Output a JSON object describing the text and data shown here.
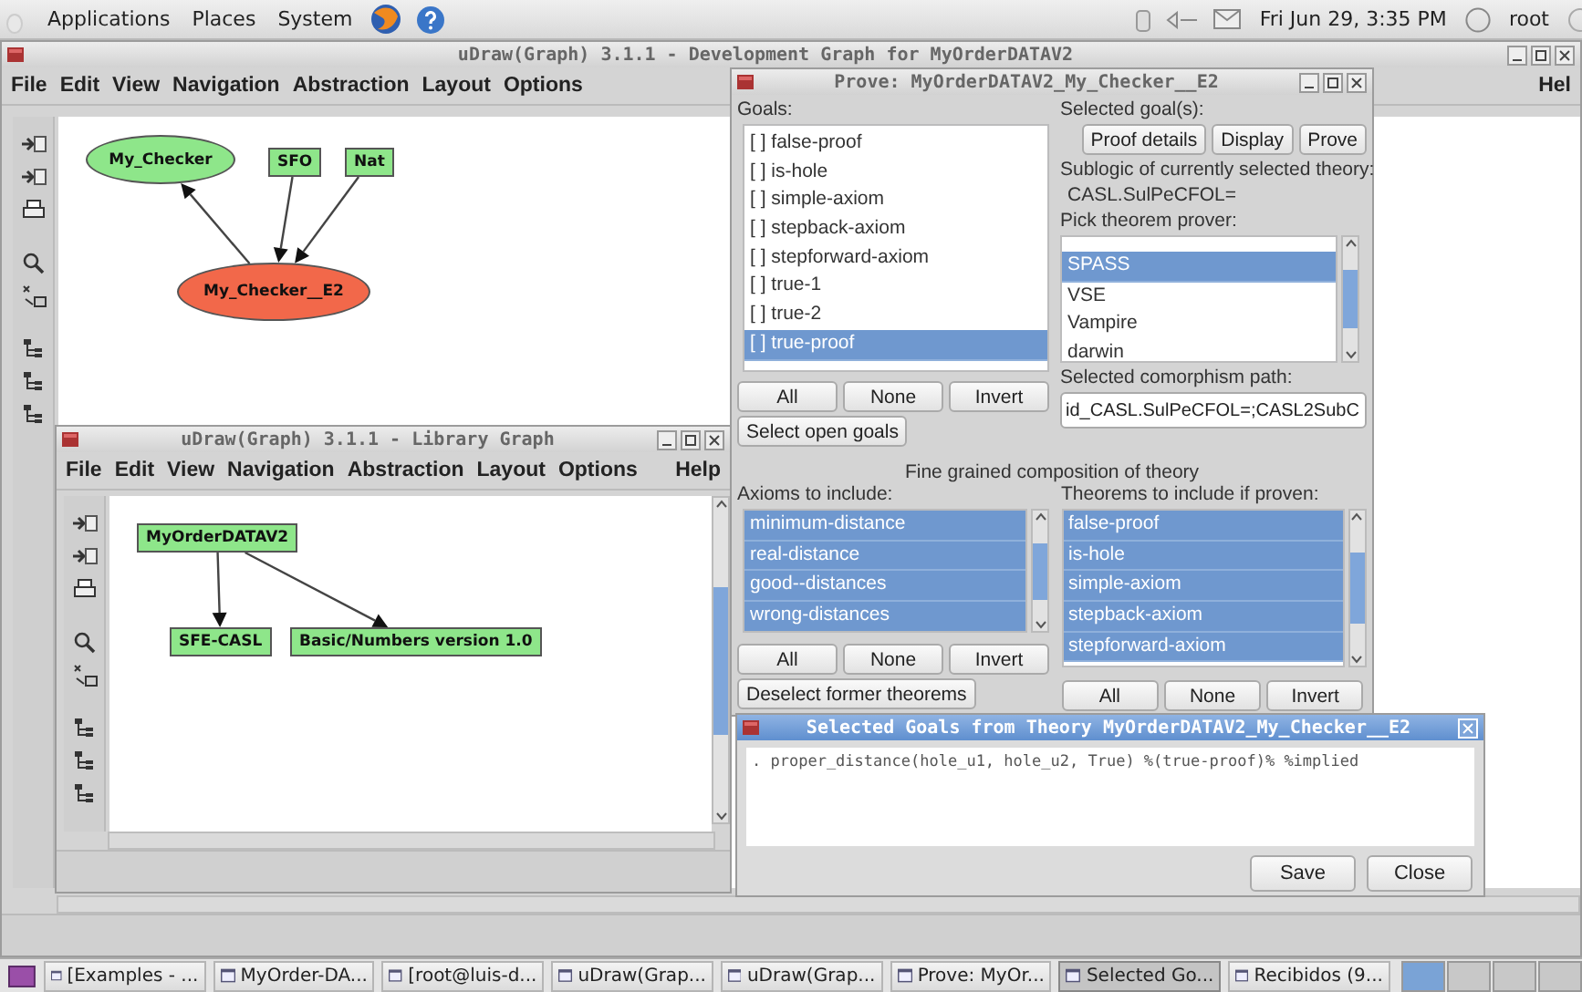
{
  "top_panel": {
    "menus": [
      "Applications",
      "Places",
      "System"
    ],
    "clock": "Fri Jun 29, 3:35 PM",
    "user": "root"
  },
  "main_window": {
    "title": "uDraw(Graph) 3.1.1 - Development Graph for MyOrderDATAV2",
    "menu": [
      "File",
      "Edit",
      "View",
      "Navigation",
      "Abstraction",
      "Layout",
      "Options"
    ],
    "help_menu": "Hel",
    "nodes": [
      {
        "label": "My_Checker",
        "kind": "ellipse",
        "color": "#8ee68a"
      },
      {
        "label": "SFO",
        "kind": "box",
        "color": "#8ee68a"
      },
      {
        "label": "Nat",
        "kind": "box",
        "color": "#8ee68a"
      },
      {
        "label": "My_Checker__E2",
        "kind": "ellipse",
        "color": "#f2684a"
      }
    ]
  },
  "library_window": {
    "title": "uDraw(Graph) 3.1.1 - Library Graph",
    "menu": [
      "File",
      "Edit",
      "View",
      "Navigation",
      "Abstraction",
      "Layout",
      "Options"
    ],
    "help_menu": "Help",
    "nodes": [
      {
        "label": "MyOrderDATAV2",
        "kind": "box",
        "color": "#8ee68a"
      },
      {
        "label": "SFE-CASL",
        "kind": "box",
        "color": "#8ee68a"
      },
      {
        "label": "Basic/Numbers version 1.0",
        "kind": "box",
        "color": "#8ee68a"
      }
    ]
  },
  "prove_window": {
    "title": "Prove: MyOrderDATAV2_My_Checker__E2",
    "goals_label": "Goals:",
    "goals": [
      {
        "label": "[ ] false-proof",
        "selected": false
      },
      {
        "label": "[ ] is-hole",
        "selected": false
      },
      {
        "label": "[ ] simple-axiom",
        "selected": false
      },
      {
        "label": "[ ] stepback-axiom",
        "selected": false
      },
      {
        "label": "[ ] stepforward-axiom",
        "selected": false
      },
      {
        "label": "[ ] true-1",
        "selected": false
      },
      {
        "label": "[ ] true-2",
        "selected": false
      },
      {
        "label": "[ ] true-proof",
        "selected": true
      }
    ],
    "goal_buttons": [
      "All",
      "None",
      "Invert"
    ],
    "select_open_goals": "Select open goals",
    "selected_goals_label": "Selected goal(s):",
    "action_buttons": [
      "Proof details",
      "Display",
      "Prove"
    ],
    "sublogic_label": "Sublogic of currently selected theory:",
    "sublogic": "CASL.SulPeCFOL=",
    "prover_label": "Pick theorem prover:",
    "provers": [
      {
        "label": "SPASS",
        "selected": true
      },
      {
        "label": "VSE",
        "selected": false
      },
      {
        "label": "Vampire",
        "selected": false
      },
      {
        "label": "darwin",
        "selected": false
      }
    ],
    "comorphism_label": "Selected comorphism path:",
    "comorphism": "id_CASL.SulPeCFOL=;CASL2SubC",
    "fine_grained_label": "Fine grained composition of theory",
    "axioms_label": "Axioms to include:",
    "axioms": [
      {
        "label": "minimum-distance",
        "selected": true
      },
      {
        "label": "real-distance",
        "selected": true
      },
      {
        "label": "good--distances",
        "selected": true
      },
      {
        "label": "wrong-distances",
        "selected": true
      }
    ],
    "axiom_buttons": [
      "All",
      "None",
      "Invert"
    ],
    "deselect_button": "Deselect former theorems",
    "theorems_label": "Theorems to include if proven:",
    "theorems": [
      {
        "label": "false-proof",
        "selected": true
      },
      {
        "label": "is-hole",
        "selected": true
      },
      {
        "label": "simple-axiom",
        "selected": true
      },
      {
        "label": "stepback-axiom",
        "selected": true
      },
      {
        "label": "stepforward-axiom",
        "selected": true
      }
    ],
    "theorem_buttons": [
      "All",
      "None",
      "Invert"
    ]
  },
  "goals_dialog": {
    "title": "Selected Goals from Theory MyOrderDATAV2_My_Checker__E2",
    "text": ". proper_distance(hole_u1, hole_u2, True) %(true-proof)% %implied",
    "buttons": [
      "Save",
      "Close"
    ]
  },
  "taskbar": {
    "items": [
      {
        "label": "[Examples - ...",
        "selected": false
      },
      {
        "label": "MyOrder-DA...",
        "selected": false
      },
      {
        "label": "[root@luis-d...",
        "selected": false
      },
      {
        "label": "uDraw(Grap...",
        "selected": false
      },
      {
        "label": "uDraw(Grap...",
        "selected": false
      },
      {
        "label": "Prove: MyOr...",
        "selected": false
      },
      {
        "label": "Selected Go...",
        "selected": true
      },
      {
        "label": "Recibidos (9...",
        "selected": false
      }
    ]
  }
}
